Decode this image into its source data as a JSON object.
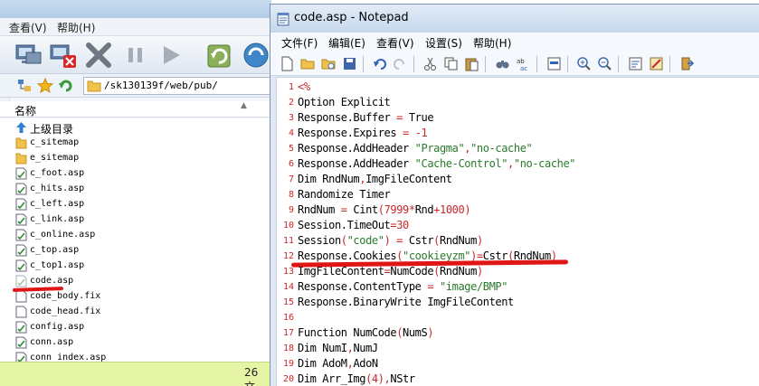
{
  "ftp_client": {
    "menu": [
      {
        "label": "查看(V)"
      },
      {
        "label": "帮助(H)"
      }
    ],
    "address_path": "/sk130139f/web/pub/",
    "list_header": "名称",
    "up_folder_label": "上级目录",
    "files": [
      {
        "name": "c_sitemap",
        "kind": "folder"
      },
      {
        "name": "e_sitemap",
        "kind": "folder"
      },
      {
        "name": "c_foot.asp",
        "kind": "asp"
      },
      {
        "name": "c_hits.asp",
        "kind": "asp"
      },
      {
        "name": "c_left.asp",
        "kind": "asp"
      },
      {
        "name": "c_link.asp",
        "kind": "asp"
      },
      {
        "name": "c_online.asp",
        "kind": "asp"
      },
      {
        "name": "c_top.asp",
        "kind": "asp"
      },
      {
        "name": "c_top1.asp",
        "kind": "asp"
      },
      {
        "name": "code.asp",
        "kind": "asp-faded"
      },
      {
        "name": "code_body.fix",
        "kind": "fix"
      },
      {
        "name": "code_head.fix",
        "kind": "fix"
      },
      {
        "name": "config.asp",
        "kind": "asp"
      },
      {
        "name": "conn.asp",
        "kind": "asp"
      },
      {
        "name": "conn_index.asp",
        "kind": "asp"
      }
    ],
    "status_count": "26 文"
  },
  "notepad": {
    "title": "code.asp - Notepad",
    "menu": [
      {
        "label": "文件(F)"
      },
      {
        "label": "编辑(E)"
      },
      {
        "label": "查看(V)"
      },
      {
        "label": "设置(S)"
      },
      {
        "label": "帮助(H)"
      }
    ],
    "lines": [
      {
        "n": "1",
        "t": "<%"
      },
      {
        "n": "2",
        "t": "Option Explicit"
      },
      {
        "n": "3",
        "t": "Response.Buffer = True"
      },
      {
        "n": "4",
        "t": "Response.Expires = -1"
      },
      {
        "n": "5",
        "t": "Response.AddHeader \"Pragma\",\"no-cache\""
      },
      {
        "n": "6",
        "t": "Response.AddHeader \"Cache-Control\",\"no-cache\""
      },
      {
        "n": "7",
        "t": "Dim RndNum,ImgFileContent"
      },
      {
        "n": "8",
        "t": "Randomize Timer"
      },
      {
        "n": "9",
        "t": "RndNum = Cint(7999*Rnd+1000)"
      },
      {
        "n": "10",
        "t": "Session.TimeOut=30"
      },
      {
        "n": "11",
        "t": "Session(\"code\") = Cstr(RndNum)"
      },
      {
        "n": "12",
        "t": "Response.Cookies(\"cookieyzm\")=Cstr(RndNum)"
      },
      {
        "n": "13",
        "t": "ImgFileContent=NumCode(RndNum)"
      },
      {
        "n": "14",
        "t": "Response.ContentType = \"image/BMP\""
      },
      {
        "n": "15",
        "t": "Response.BinaryWrite ImgFileContent"
      },
      {
        "n": "16",
        "t": ""
      },
      {
        "n": "17",
        "t": "Function NumCode(NumS)"
      },
      {
        "n": "18",
        "t": "Dim NumI,NumJ"
      },
      {
        "n": "19",
        "t": "Dim AdoM,AdoN"
      },
      {
        "n": "20",
        "t": "Dim Arr_Img(4),NStr"
      }
    ]
  },
  "colors": {
    "line_number": "#c8272a",
    "string": "#2a7a2a",
    "highlight_mark": "#e01616",
    "status_bar": "#e6f4a6"
  }
}
